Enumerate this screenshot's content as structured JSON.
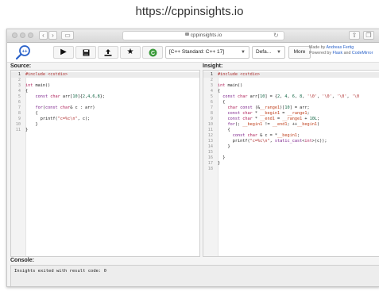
{
  "caption": "https://cppinsights.io",
  "browser": {
    "url": "cppinsights.io",
    "back_icon": "chevron-left-icon",
    "forward_icon": "chevron-right-icon"
  },
  "toolbar": {
    "logo_icon": "cpp-insights-logo",
    "run_label": "▶",
    "save_label": "💾",
    "share_label": "⇪",
    "star_label": "★",
    "cppref_label": "C",
    "standard_value": "[C++ Standard: C++ 17]",
    "standard_arrow": "▼",
    "default_value": "Defa...",
    "default_arrow": "▼",
    "more_label": "More",
    "credits_line1_prefix": "Made by ",
    "credits_line1_author": "Andreas Fertig",
    "credits_line2_prefix": "Powered by ",
    "credits_line2_flask": "Flask",
    "credits_line2_and": " and ",
    "credits_line2_cm": "CodeMirror"
  },
  "colors": {
    "keyword": "#7a1f8a",
    "type": "#b0225b",
    "preprocessor": "#b03030",
    "number": "#116644",
    "variable": "#c0421f"
  },
  "source": {
    "label": "Source:",
    "lines": [
      {
        "n": "1",
        "tokens": [
          {
            "t": "#include <cstdio>",
            "c": "pp"
          }
        ]
      },
      {
        "n": "2",
        "tokens": []
      },
      {
        "n": "3",
        "tokens": [
          {
            "t": "int",
            "c": "ty"
          },
          {
            "t": " main()",
            "c": "tx"
          }
        ]
      },
      {
        "n": "4",
        "tokens": [
          {
            "t": "{",
            "c": "tx"
          }
        ]
      },
      {
        "n": "5",
        "tokens": [
          {
            "t": "    ",
            "c": "tx"
          },
          {
            "t": "const",
            "c": "kw"
          },
          {
            "t": " ",
            "c": "tx"
          },
          {
            "t": "char",
            "c": "ty"
          },
          {
            "t": " arr[",
            "c": "tx"
          },
          {
            "t": "10",
            "c": "num"
          },
          {
            "t": "]{",
            "c": "tx"
          },
          {
            "t": "2",
            "c": "num"
          },
          {
            "t": ",",
            "c": "tx"
          },
          {
            "t": "4",
            "c": "num"
          },
          {
            "t": ",",
            "c": "tx"
          },
          {
            "t": "6",
            "c": "num"
          },
          {
            "t": ",",
            "c": "tx"
          },
          {
            "t": "8",
            "c": "num"
          },
          {
            "t": "};",
            "c": "tx"
          }
        ]
      },
      {
        "n": "6",
        "tokens": []
      },
      {
        "n": "7",
        "tokens": [
          {
            "t": "    ",
            "c": "tx"
          },
          {
            "t": "for",
            "c": "kw"
          },
          {
            "t": "(",
            "c": "tx"
          },
          {
            "t": "const",
            "c": "kw"
          },
          {
            "t": " ",
            "c": "tx"
          },
          {
            "t": "char",
            "c": "ty"
          },
          {
            "t": "& c : arr)",
            "c": "tx"
          }
        ]
      },
      {
        "n": "8",
        "tokens": [
          {
            "t": "    {",
            "c": "tx"
          }
        ]
      },
      {
        "n": "9",
        "tokens": [
          {
            "t": "      printf(",
            "c": "tx"
          },
          {
            "t": "\"c=%c\\n\"",
            "c": "str"
          },
          {
            "t": ", c);",
            "c": "tx"
          }
        ]
      },
      {
        "n": "10",
        "tokens": [
          {
            "t": "    }",
            "c": "tx"
          }
        ]
      },
      {
        "n": "11",
        "tokens": [
          {
            "t": "}",
            "c": "tx"
          }
        ]
      }
    ]
  },
  "insight": {
    "label": "Insight:",
    "lines": [
      {
        "n": "1",
        "tokens": [
          {
            "t": "#include <cstdio>",
            "c": "pp"
          }
        ]
      },
      {
        "n": "2",
        "tokens": []
      },
      {
        "n": "3",
        "tokens": [
          {
            "t": "int",
            "c": "ty"
          },
          {
            "t": " main()",
            "c": "tx"
          }
        ]
      },
      {
        "n": "4",
        "tokens": [
          {
            "t": "{",
            "c": "tx"
          }
        ]
      },
      {
        "n": "5",
        "tokens": [
          {
            "t": "  ",
            "c": "tx"
          },
          {
            "t": "const",
            "c": "kw"
          },
          {
            "t": " ",
            "c": "tx"
          },
          {
            "t": "char",
            "c": "ty"
          },
          {
            "t": " arr[",
            "c": "tx"
          },
          {
            "t": "10",
            "c": "num"
          },
          {
            "t": "] = {",
            "c": "tx"
          },
          {
            "t": "2",
            "c": "num"
          },
          {
            "t": ", ",
            "c": "tx"
          },
          {
            "t": "4",
            "c": "num"
          },
          {
            "t": ", ",
            "c": "tx"
          },
          {
            "t": "6",
            "c": "num"
          },
          {
            "t": ", ",
            "c": "tx"
          },
          {
            "t": "8",
            "c": "num"
          },
          {
            "t": ", ",
            "c": "tx"
          },
          {
            "t": "'\\0'",
            "c": "str"
          },
          {
            "t": ", ",
            "c": "tx"
          },
          {
            "t": "'\\0'",
            "c": "str"
          },
          {
            "t": ", ",
            "c": "tx"
          },
          {
            "t": "'\\0'",
            "c": "str"
          },
          {
            "t": ", ",
            "c": "tx"
          },
          {
            "t": "'\\0",
            "c": "str"
          }
        ]
      },
      {
        "n": "6",
        "tokens": [
          {
            "t": "  {",
            "c": "tx"
          }
        ]
      },
      {
        "n": "7",
        "tokens": [
          {
            "t": "    ",
            "c": "tx"
          },
          {
            "t": "char",
            "c": "ty"
          },
          {
            "t": " ",
            "c": "tx"
          },
          {
            "t": "const",
            "c": "kw"
          },
          {
            "t": " (&",
            "c": "tx"
          },
          {
            "t": "__range1",
            "c": "var"
          },
          {
            "t": ")[",
            "c": "tx"
          },
          {
            "t": "10",
            "c": "num"
          },
          {
            "t": "] = arr;",
            "c": "tx"
          }
        ]
      },
      {
        "n": "8",
        "tokens": [
          {
            "t": "    ",
            "c": "tx"
          },
          {
            "t": "const",
            "c": "kw"
          },
          {
            "t": " ",
            "c": "tx"
          },
          {
            "t": "char",
            "c": "ty"
          },
          {
            "t": " * ",
            "c": "tx"
          },
          {
            "t": "__begin1",
            "c": "var"
          },
          {
            "t": " = ",
            "c": "tx"
          },
          {
            "t": "__range1",
            "c": "var"
          },
          {
            "t": ";",
            "c": "tx"
          }
        ]
      },
      {
        "n": "9",
        "tokens": [
          {
            "t": "    ",
            "c": "tx"
          },
          {
            "t": "const",
            "c": "kw"
          },
          {
            "t": " ",
            "c": "tx"
          },
          {
            "t": "char",
            "c": "ty"
          },
          {
            "t": " * ",
            "c": "tx"
          },
          {
            "t": "__end1",
            "c": "var"
          },
          {
            "t": " = ",
            "c": "tx"
          },
          {
            "t": "__range1",
            "c": "var"
          },
          {
            "t": " + ",
            "c": "tx"
          },
          {
            "t": "10L",
            "c": "num"
          },
          {
            "t": ";",
            "c": "tx"
          }
        ]
      },
      {
        "n": "10",
        "tokens": [
          {
            "t": "    ",
            "c": "tx"
          },
          {
            "t": "for",
            "c": "kw"
          },
          {
            "t": "(; ",
            "c": "tx"
          },
          {
            "t": "__begin1",
            "c": "var"
          },
          {
            "t": " != ",
            "c": "tx"
          },
          {
            "t": "__end1",
            "c": "var"
          },
          {
            "t": "; ++",
            "c": "tx"
          },
          {
            "t": "__begin1",
            "c": "var"
          },
          {
            "t": ")",
            "c": "tx"
          }
        ]
      },
      {
        "n": "11",
        "tokens": [
          {
            "t": "    {",
            "c": "tx"
          }
        ]
      },
      {
        "n": "12",
        "tokens": [
          {
            "t": "      ",
            "c": "tx"
          },
          {
            "t": "const",
            "c": "kw"
          },
          {
            "t": " ",
            "c": "tx"
          },
          {
            "t": "char",
            "c": "ty"
          },
          {
            "t": " & c = *",
            "c": "tx"
          },
          {
            "t": "__begin1",
            "c": "var"
          },
          {
            "t": ";",
            "c": "tx"
          }
        ]
      },
      {
        "n": "13",
        "tokens": [
          {
            "t": "      printf(",
            "c": "tx"
          },
          {
            "t": "\"c=%c\\n\"",
            "c": "str"
          },
          {
            "t": ", ",
            "c": "tx"
          },
          {
            "t": "static_cast",
            "c": "kw"
          },
          {
            "t": "<",
            "c": "tx"
          },
          {
            "t": "int",
            "c": "ty"
          },
          {
            "t": ">(c));",
            "c": "tx"
          }
        ]
      },
      {
        "n": "14",
        "tokens": [
          {
            "t": "    }",
            "c": "tx"
          }
        ]
      },
      {
        "n": "15",
        "tokens": []
      },
      {
        "n": "16",
        "tokens": [
          {
            "t": "  }",
            "c": "tx"
          }
        ]
      },
      {
        "n": "17",
        "tokens": [
          {
            "t": "}",
            "c": "tx"
          }
        ]
      },
      {
        "n": "18",
        "tokens": []
      }
    ]
  },
  "console": {
    "label": "Console:",
    "output": "Insights exited with result code: 0"
  }
}
